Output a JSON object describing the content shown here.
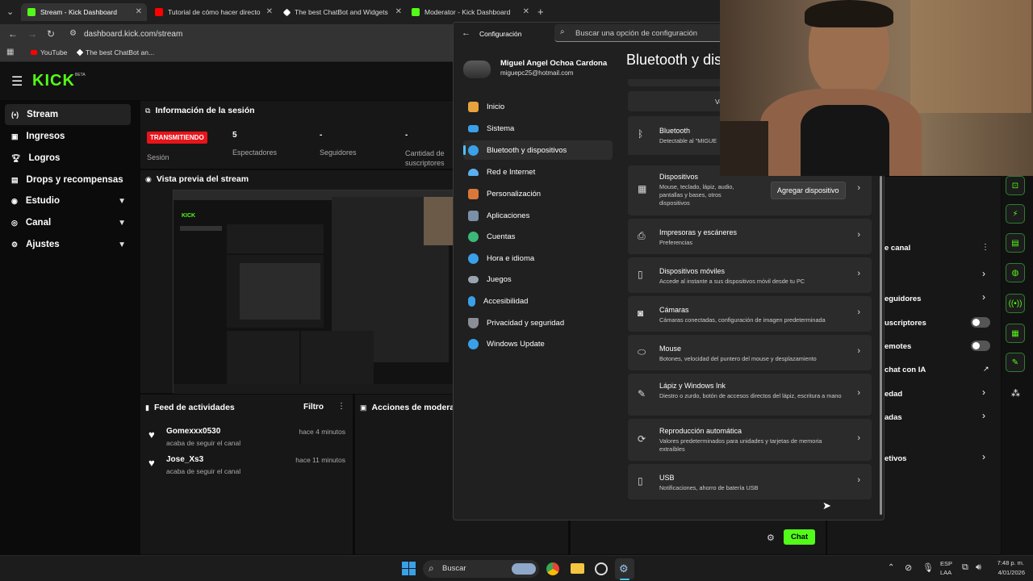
{
  "browser": {
    "tabs": [
      {
        "title": "Stream - Kick Dashboard",
        "color": "#53fc18"
      },
      {
        "title": "Tutorial de cómo hacer directo",
        "color": "#ff0000"
      },
      {
        "title": "The best ChatBot and Widgets",
        "color": "#ffffff"
      },
      {
        "title": "Moderator - Kick Dashboard",
        "color": "#53fc18"
      }
    ],
    "url": "dashboard.kick.com/stream",
    "bookmarks": [
      "YouTube",
      "The best ChatBot an..."
    ]
  },
  "kick": {
    "logo": "KICK",
    "logo_badge": "BETA",
    "nav": [
      "Stream",
      "Ingresos",
      "Logros",
      "Drops y recompensas",
      "Estudio",
      "Canal",
      "Ajustes"
    ],
    "session": {
      "title": "Información de la sesión",
      "live_badge": "TRANSMITIENDO",
      "session_label": "Sesión",
      "viewers_value": "5",
      "viewers_label": "Espectadores",
      "followers_value": "-",
      "followers_label": "Seguidores",
      "subs_value": "-",
      "subs_label": "Cantidad de suscriptores"
    },
    "preview_title": "Vista previa del stream",
    "feed": {
      "title": "Feed de actividades",
      "filter": "Filtro",
      "items": [
        {
          "user": "Gomexxx0530",
          "action": "acaba de seguir el canal",
          "time": "hace 4 minutos"
        },
        {
          "user": "Jose_Xs3",
          "action": "acaba de seguir el canal",
          "time": "hace 11 minutos"
        }
      ]
    },
    "mod_title": "Acciones de moderación",
    "right_panel": {
      "title": "e canal",
      "items": [
        "eguidores",
        "uscriptores",
        "emotes",
        "chat con IA",
        "edad",
        "adas",
        "etivos"
      ]
    },
    "chat_button": "Chat"
  },
  "settings": {
    "window_title": "Configuración",
    "search_placeholder": "Buscar una opción de configuración",
    "user_name": "Miguel Angel Ochoa Cardona",
    "user_email": "miguepc25@hotmail.com",
    "page_title": "Bluetooth y dispositivos",
    "nav": [
      {
        "label": "Inicio",
        "color": "#e8a33d"
      },
      {
        "label": "Sistema",
        "color": "#3aa0e8"
      },
      {
        "label": "Bluetooth y dispositivos",
        "color": "#3aa0e8"
      },
      {
        "label": "Red e Internet",
        "color": "#5ab0f0"
      },
      {
        "label": "Personalización",
        "color": "#d9783a"
      },
      {
        "label": "Aplicaciones",
        "color": "#7a8fa8"
      },
      {
        "label": "Cuentas",
        "color": "#3cb878"
      },
      {
        "label": "Hora e idioma",
        "color": "#3aa0e8"
      },
      {
        "label": "Juegos",
        "color": "#9aa4b0"
      },
      {
        "label": "Accesibilidad",
        "color": "#3aa0e8"
      },
      {
        "label": "Privacidad y seguridad",
        "color": "#8a8f96"
      },
      {
        "label": "Windows Update",
        "color": "#3aa0e8"
      }
    ],
    "partial_button": "Ve",
    "bluetooth": {
      "title": "Bluetooth",
      "desc": "Detectable al \"MIGUE"
    },
    "devices": {
      "title": "Dispositivos",
      "desc": "Mouse, teclado, lápiz, audio, pantallas y bases, otros dispositivos",
      "button": "Agregar dispositivo"
    },
    "cards": [
      {
        "title": "Impresoras y escáneres",
        "desc": "Preferencias",
        "icon": "printer-icon"
      },
      {
        "title": "Dispositivos móviles",
        "desc": "Accede al instante a sus dispositivos móvil desde tu PC",
        "icon": "phone-icon"
      },
      {
        "title": "Cámaras",
        "desc": "Cámaras conectadas, configuración de imagen predeterminada",
        "icon": "camera-icon"
      },
      {
        "title": "Mouse",
        "desc": "Botones, velocidad del puntero del mouse y desplazamiento",
        "icon": "mouse-icon"
      },
      {
        "title": "Lápiz y Windows Ink",
        "desc": "Diestro o zurdo, botón de accesos directos del lápiz, escritura a mano",
        "icon": "pen-icon"
      },
      {
        "title": "Reproducción automática",
        "desc": "Valores predeterminados para unidades y tarjetas de memoria extraíbles",
        "icon": "autoplay-icon"
      },
      {
        "title": "USB",
        "desc": "Notificaciones, ahorro de batería USB",
        "icon": "usb-icon"
      }
    ]
  },
  "taskbar": {
    "search": "Buscar",
    "lang_top": "ESP",
    "lang_bottom": "LAA",
    "time": "7:48 p. m.",
    "date": "4/01/2026"
  }
}
